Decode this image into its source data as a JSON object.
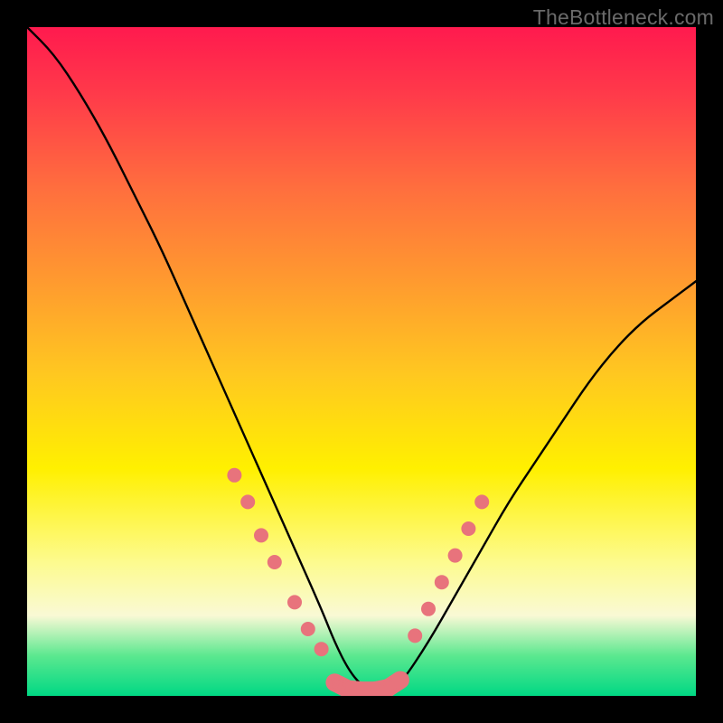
{
  "watermark": "TheBottleneck.com",
  "chart_data": {
    "type": "line",
    "title": "",
    "xlabel": "",
    "ylabel": "",
    "xlim": [
      0,
      100
    ],
    "ylim": [
      0,
      100
    ],
    "grid": false,
    "series": [
      {
        "name": "bottleneck-curve",
        "x": [
          0,
          4,
          8,
          12,
          16,
          20,
          24,
          28,
          32,
          36,
          40,
          44,
          46,
          48,
          50,
          52,
          54,
          56,
          60,
          64,
          68,
          72,
          76,
          80,
          84,
          88,
          92,
          96,
          100
        ],
        "values": [
          100,
          96,
          90,
          83,
          75,
          67,
          58,
          49,
          40,
          31,
          22,
          13,
          8,
          4,
          1.5,
          0.5,
          0.5,
          2,
          8,
          15,
          22,
          29,
          35,
          41,
          47,
          52,
          56,
          59,
          62
        ]
      },
      {
        "name": "data-points-left",
        "x": [
          31,
          33,
          35,
          37,
          40,
          42,
          44
        ],
        "values": [
          33,
          29,
          24,
          20,
          14,
          10,
          7
        ]
      },
      {
        "name": "data-points-right",
        "x": [
          58,
          60,
          62,
          64,
          66,
          68
        ],
        "values": [
          9,
          13,
          17,
          21,
          25,
          29
        ]
      },
      {
        "name": "bottom-run",
        "x": [
          46,
          48,
          50,
          52,
          54,
          56
        ],
        "values": [
          2,
          1,
          0.8,
          0.8,
          1.2,
          2.5
        ]
      }
    ],
    "colors": {
      "curve_stroke": "#000000",
      "marker_fill": "#e8737c",
      "marker_stroke": "#d95f69",
      "gradient_top": "#ff1a4e",
      "gradient_mid": "#fff000",
      "gradient_bottom": "#00d884"
    }
  }
}
